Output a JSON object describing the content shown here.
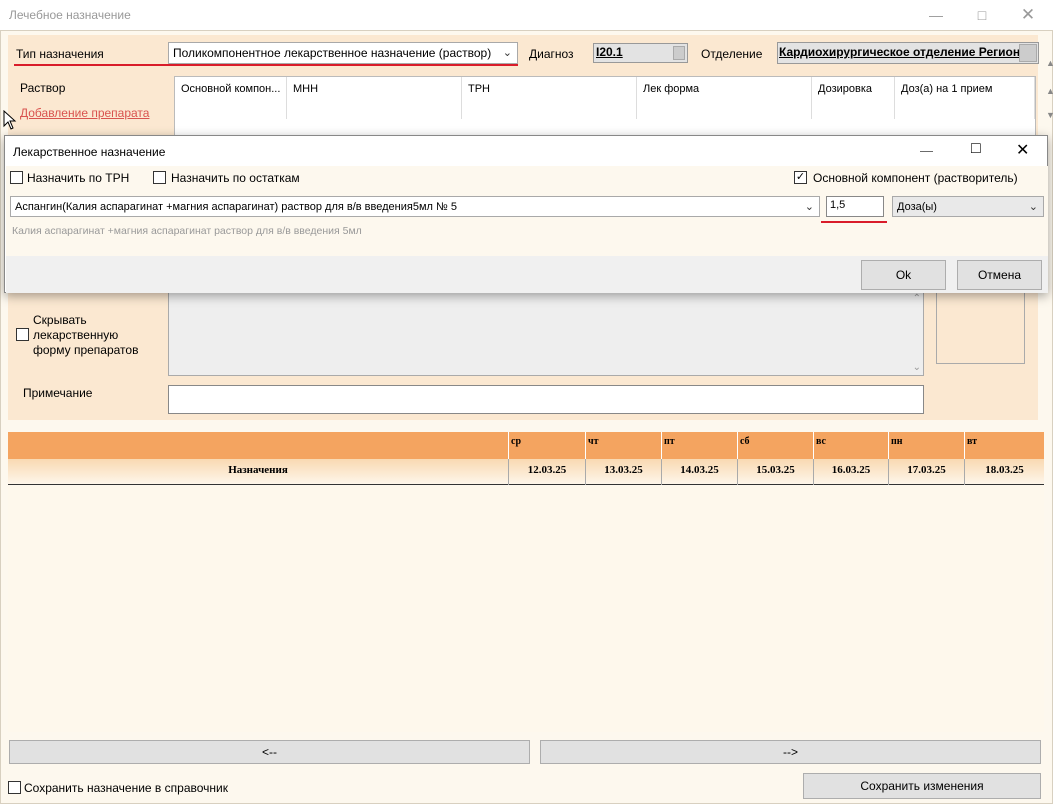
{
  "window": {
    "title": "Лечебное назначение"
  },
  "form": {
    "type_label": "Тип назначения",
    "type_value": "Поликомпонентное лекарственное назначение (раствор)",
    "diagnosis_label": "Диагноз",
    "diagnosis_value": "I20.1",
    "department_label": "Отделение",
    "department_value": "Кардиохирургическое отделение Регион",
    "solution_label": "Раствор",
    "add_drug_link": "Добавление препарата",
    "hide_form_label": "Скрывать лекарственную форму препаратов",
    "note_label": "Примечание",
    "note_value": ""
  },
  "grid": {
    "columns": [
      "Основной компон...",
      "МНН",
      "ТРН",
      "Лек форма",
      "Дозировка",
      "Доз(а) на 1 прием"
    ]
  },
  "dialog": {
    "title": "Лекарственное назначение",
    "by_trn_label": "Назначить по ТРН",
    "by_trn_checked": false,
    "by_remains_label": "Назначить по остаткам",
    "by_remains_checked": false,
    "main_component_label": "Основной компонент (растворитель)",
    "main_component_checked": true,
    "drug_value": "Аспангин(Калия аспарагинат +магния аспарагинат) раствор для в/в введения5мл № 5",
    "dose_value": "1,5",
    "dose_unit": "Доза(ы)",
    "drug_hint": "Калия аспарагинат +магния аспарагинат раствор для в/в введения 5мл",
    "ok_label": "Ok",
    "cancel_label": "Отмена"
  },
  "schedule": {
    "row_label": "Назначения",
    "days": [
      "ср",
      "чт",
      "пт",
      "сб",
      "вс",
      "пн",
      "вт"
    ],
    "dates": [
      "12.03.25",
      "13.03.25",
      "14.03.25",
      "15.03.25",
      "16.03.25",
      "17.03.25",
      "18.03.25"
    ]
  },
  "footer": {
    "prev_label": "<--",
    "next_label": "-->",
    "save_to_ref_label": "Сохранить назначение в справочник",
    "save_to_ref_checked": false,
    "save_changes_label": "Сохранить изменения"
  },
  "colors": {
    "panel": "#fbe8d1",
    "schedule_header": "#f4a460",
    "highlight_underline": "#d91c2a",
    "link": "#d9534f"
  }
}
